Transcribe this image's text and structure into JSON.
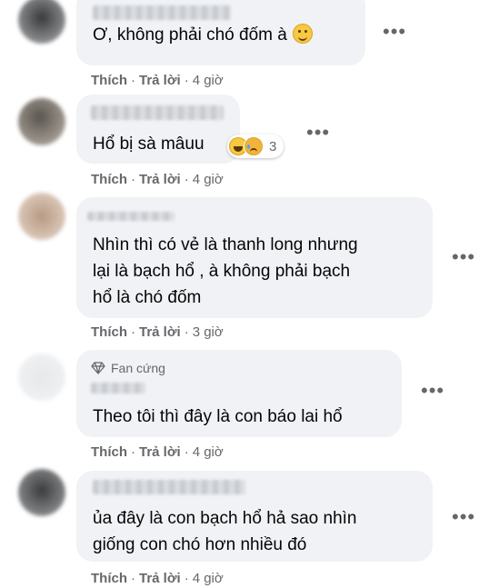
{
  "labels": {
    "like": "Thích",
    "reply": "Trả lời",
    "separator": "·",
    "more": "•••"
  },
  "comments": [
    {
      "text": "Ơ, không phải chó đốm à",
      "time": "4 giờ"
    },
    {
      "text": "Hổ bị sà mâuu",
      "time": "4 giờ",
      "reaction_count": "3",
      "reaction_icons": [
        "haha-icon",
        "sad-icon"
      ]
    },
    {
      "lines": [
        "Nhìn thì có vẻ là thanh long nhưng",
        "lại là bạch hổ , à không phải bạch",
        "hổ là chó đốm"
      ],
      "time": "3 giờ"
    },
    {
      "badge": "Fan cứng",
      "text": "Theo tôi thì đây là con báo lai hổ",
      "time": "4 giờ"
    },
    {
      "lines": [
        "ủa đây là con bạch hổ hả sao nhìn",
        "giống con chó hơn nhiều đó"
      ],
      "time": "4 giờ"
    }
  ],
  "colors": {
    "bubble": "#f0f2f5",
    "meta_text": "#65676b",
    "text": "#050505"
  }
}
